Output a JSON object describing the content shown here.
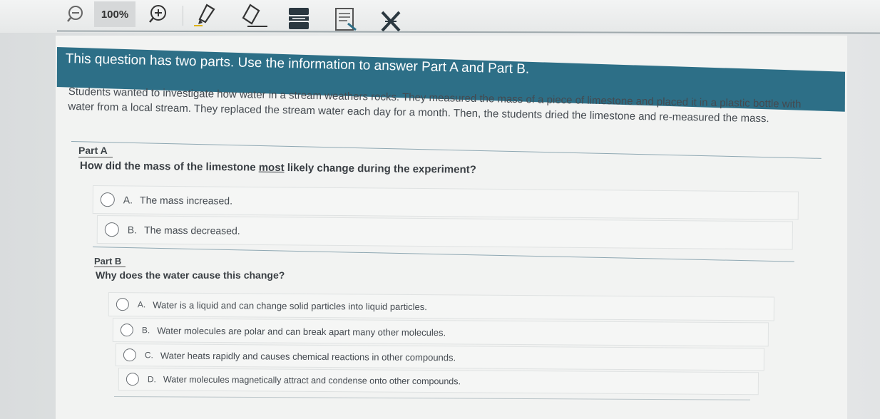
{
  "toolbar": {
    "zoom_level": "100%",
    "tools": [
      "zoom-out-icon",
      "zoom-in-icon",
      "highlighter-icon",
      "eraser-icon",
      "line-reader-icon",
      "notepad-icon",
      "answer-eliminator-icon"
    ]
  },
  "header": {
    "instruction": "This question has two parts. Use the information to answer Part A and Part B."
  },
  "stem": {
    "text": "Students wanted to investigate how water in a stream weathers rocks. They measured the mass of a piece of limestone and placed it in a plastic bottle with water from a local stream. They replaced the stream water each day for a month. Then, the students dried the limestone and re-measured the mass."
  },
  "part_a": {
    "label": "Part A",
    "question_before": "How did the mass of the limestone ",
    "question_emphasis": "most",
    "question_after": " likely change during the experiment?",
    "options": [
      {
        "letter": "A.",
        "text": "The mass increased."
      },
      {
        "letter": "B.",
        "text": "The mass decreased."
      }
    ]
  },
  "part_b": {
    "label": "Part B",
    "question": "Why does the water cause this change?",
    "options": [
      {
        "letter": "A.",
        "text": "Water is a liquid and can change solid particles into liquid particles."
      },
      {
        "letter": "B.",
        "text": "Water molecules are polar and can break apart many other molecules."
      },
      {
        "letter": "C.",
        "text": "Water heats rapidly and causes chemical reactions in other compounds."
      },
      {
        "letter": "D.",
        "text": "Water molecules magnetically attract and condense onto other compounds."
      }
    ]
  },
  "colors": {
    "header_bg": "#2d6f87",
    "panel_bg": "#f2f3f2",
    "accent_rule": "#8fa8b3"
  }
}
